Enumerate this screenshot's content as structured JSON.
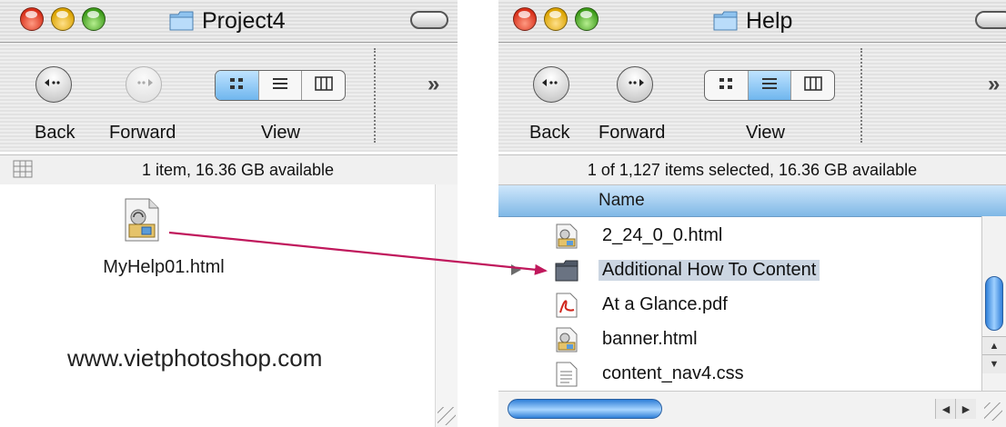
{
  "left_window": {
    "title": "Project4",
    "toolbar": {
      "back_label": "Back",
      "forward_label": "Forward",
      "view_label": "View",
      "view_mode": "icon"
    },
    "status_text": "1 item, 16.36 GB available",
    "file": {
      "name": "MyHelp01.html",
      "icon": "html-document-icon"
    },
    "watermark": "www.vietphotoshop.com"
  },
  "right_window": {
    "title": "Help",
    "toolbar": {
      "back_label": "Back",
      "forward_label": "Forward",
      "view_label": "View",
      "view_mode": "list"
    },
    "status_text": "1 of 1,127 items selected, 16.36 GB available",
    "column_header": "Name",
    "items": [
      {
        "name": "2_24_0_0.html",
        "icon": "html-document-icon",
        "selected": false
      },
      {
        "name": "Additional How To Content",
        "icon": "folder-icon",
        "selected": true
      },
      {
        "name": "At a Glance.pdf",
        "icon": "pdf-icon",
        "selected": false
      },
      {
        "name": "banner.html",
        "icon": "html-document-icon",
        "selected": false
      },
      {
        "name": "content_nav4.css",
        "icon": "text-document-icon",
        "selected": false
      }
    ]
  },
  "colors": {
    "arrow": "#c0185c",
    "selection": "#ccd6e2",
    "header_blue": "#7fb8e6",
    "accent": "#2f7fd8"
  }
}
